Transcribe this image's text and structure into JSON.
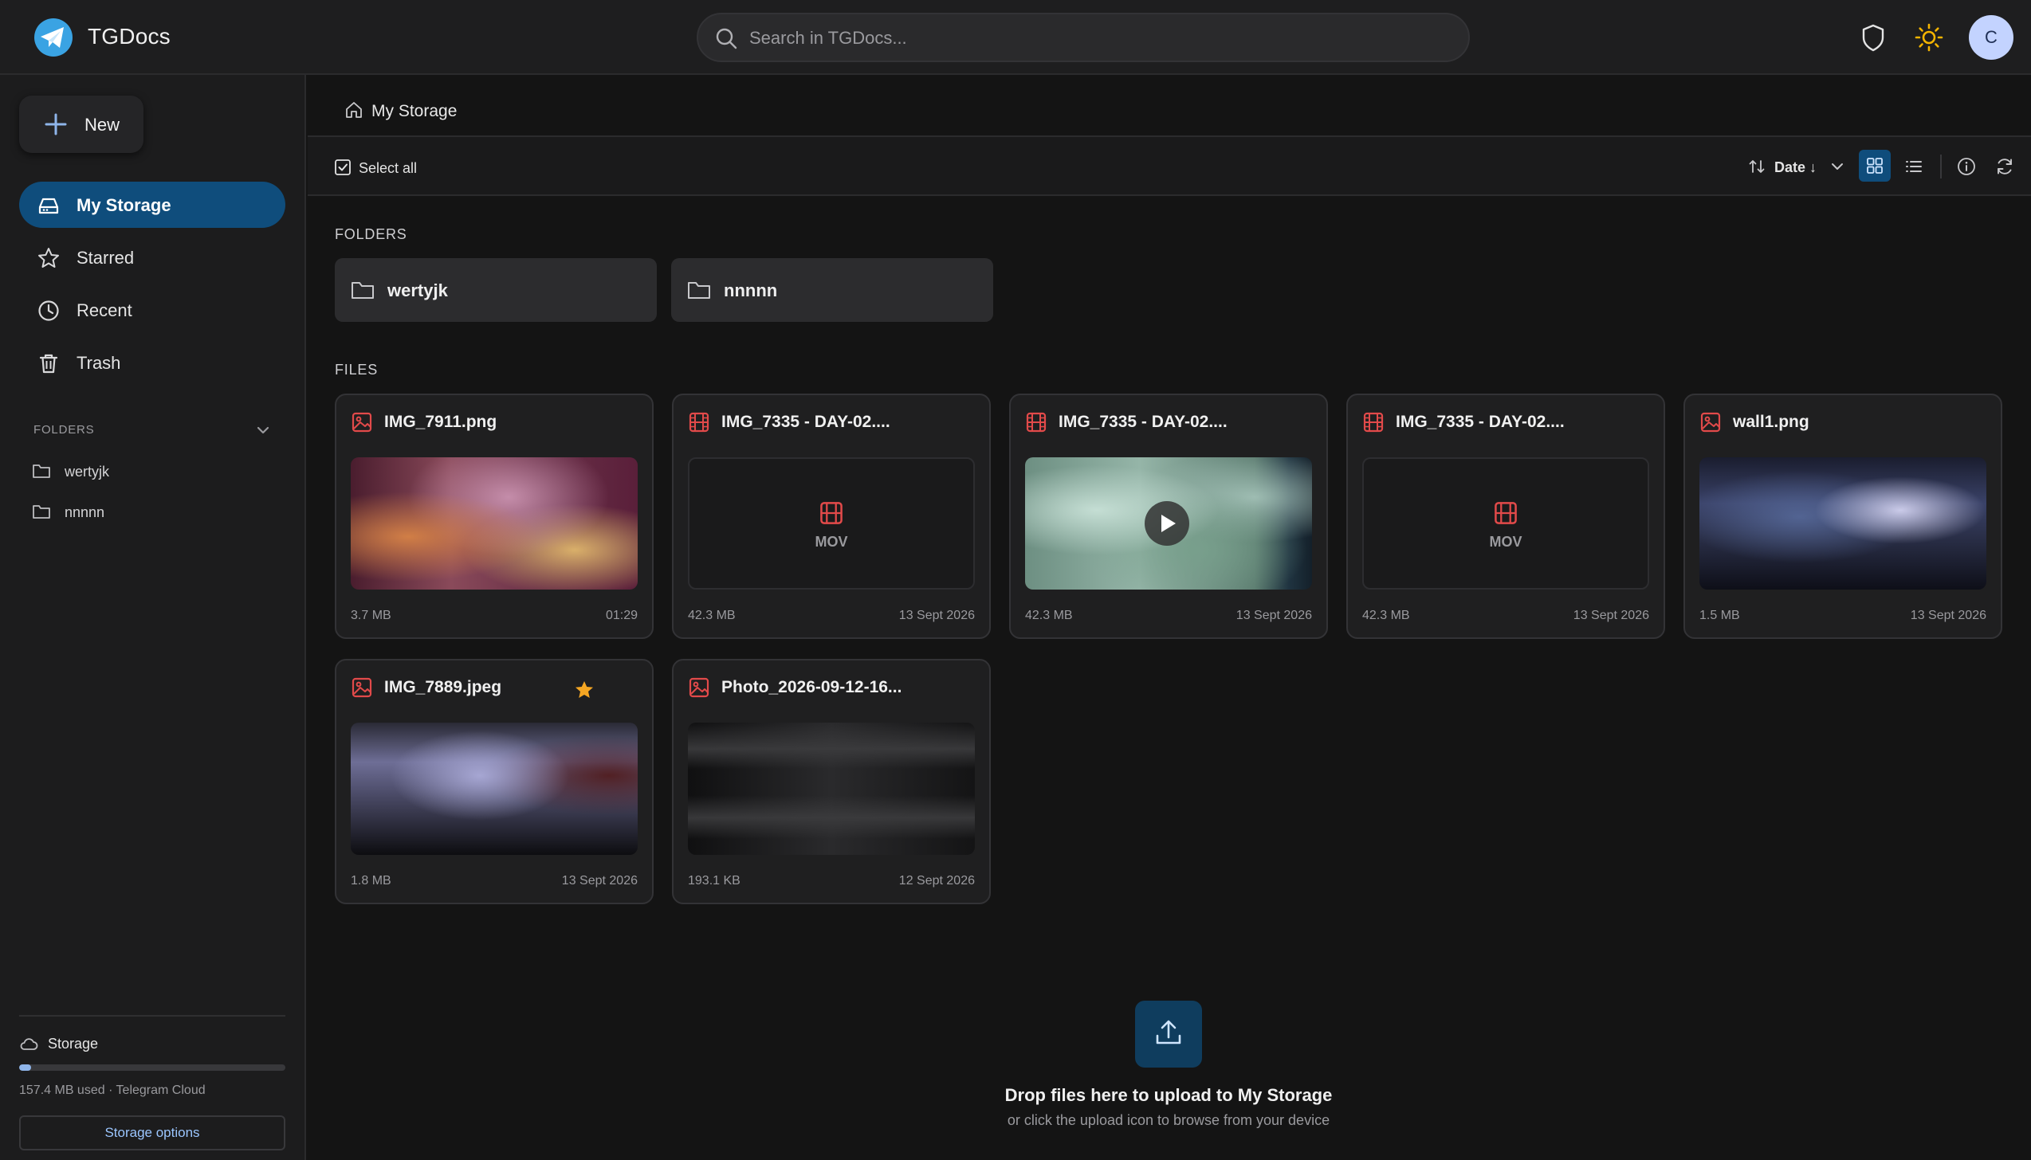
{
  "app": {
    "title": "TGDocs"
  },
  "search": {
    "placeholder": "Search in TGDocs..."
  },
  "header": {
    "avatar_letter": "C"
  },
  "sidebar": {
    "new_label": "New",
    "nav": [
      {
        "label": "My Storage",
        "icon": "drive-icon"
      },
      {
        "label": "Starred",
        "icon": "star-icon"
      },
      {
        "label": "Recent",
        "icon": "clock-icon"
      },
      {
        "label": "Trash",
        "icon": "trash-icon"
      }
    ],
    "folders_heading": "FOLDERS",
    "folders": [
      {
        "label": "wertyjk"
      },
      {
        "label": "nnnnn"
      }
    ],
    "storage": {
      "title": "Storage",
      "used_text": "157.4 MB used · Telegram Cloud",
      "used_fraction": 0.045,
      "button_label": "Storage options"
    }
  },
  "breadcrumb": {
    "label": "My Storage"
  },
  "toolbar": {
    "select_all": "Select all",
    "sort_label": "Date ↓"
  },
  "main": {
    "folders_heading": "FOLDERS",
    "files_heading": "FILES",
    "folders": [
      {
        "label": "wertyjk"
      },
      {
        "label": "nnnnn"
      }
    ],
    "files": [
      {
        "name": "IMG_7911.png",
        "type": "image",
        "size": "3.7 MB",
        "date": "01:29",
        "starred": false
      },
      {
        "name": "IMG_7335 - DAY-02....",
        "type": "video",
        "size": "42.3 MB",
        "date": "13 Sept 2026",
        "thumb_label": "MOV",
        "starred": false
      },
      {
        "name": "IMG_7335 - DAY-02....",
        "type": "video",
        "size": "42.3 MB",
        "date": "13 Sept 2026",
        "starred": false
      },
      {
        "name": "IMG_7335 - DAY-02....",
        "type": "video",
        "size": "42.3 MB",
        "date": "13 Sept 2026",
        "thumb_label": "MOV",
        "starred": false
      },
      {
        "name": "wall1.png",
        "type": "image",
        "size": "1.5 MB",
        "date": "13 Sept 2026",
        "starred": false
      },
      {
        "name": "IMG_7889.jpeg",
        "type": "image",
        "size": "1.8 MB",
        "date": "13 Sept 2026",
        "starred": true
      },
      {
        "name": "Photo_2026-09-12-16...",
        "type": "image",
        "size": "193.1 KB",
        "date": "12 Sept 2026",
        "starred": false
      }
    ]
  },
  "upload": {
    "title": "Drop files here to upload to My Storage",
    "subtitle": "or click the upload icon to browse from your device"
  },
  "colors": {
    "accent": "#0f4d7c",
    "file_icon_red": "#e24a4a",
    "star": "#f5a623",
    "background": "#141414"
  }
}
